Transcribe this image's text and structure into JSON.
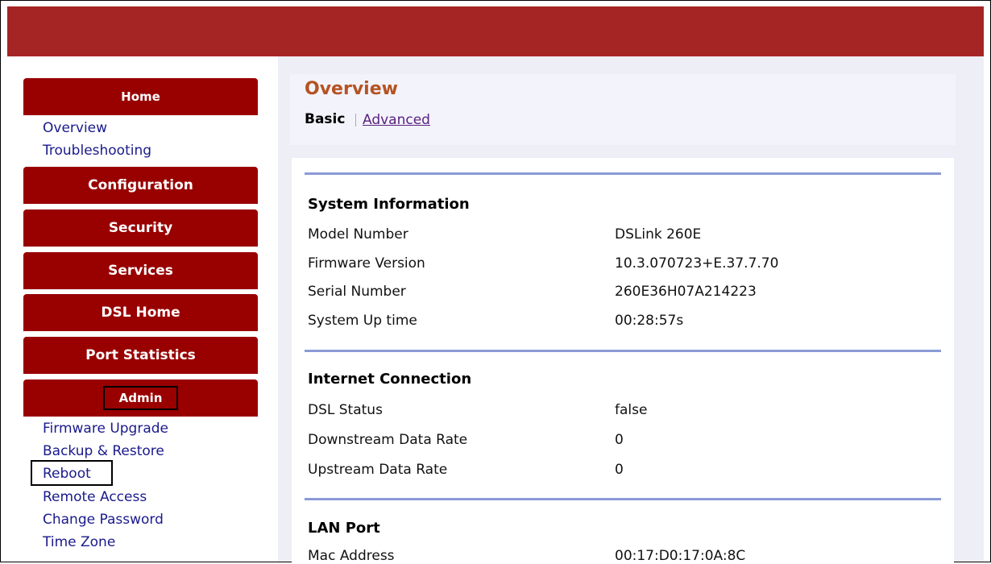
{
  "sidebar": {
    "home": {
      "header": "Home",
      "links": [
        "Overview",
        "Troubleshooting"
      ]
    },
    "configuration": "Configuration",
    "security": "Security",
    "services": "Services",
    "dsl_home": "DSL Home",
    "port_statistics": "Port Statistics",
    "admin": {
      "header": "Admin",
      "links": [
        "Firmware Upgrade",
        "Backup & Restore",
        "Reboot",
        "Remote Access",
        "Change Password",
        "Time Zone"
      ]
    }
  },
  "main": {
    "title": "Overview",
    "tabs": {
      "basic": "Basic",
      "advanced": "Advanced"
    },
    "sections": [
      {
        "title": "System Information",
        "rows": [
          {
            "label": "Model Number",
            "value": "DSLink 260E"
          },
          {
            "label": "Firmware Version",
            "value": "10.3.070723+E.37.7.70"
          },
          {
            "label": "Serial Number",
            "value": "260E36H07A214223"
          },
          {
            "label": "System Up time",
            "value": "00:28:57s"
          }
        ]
      },
      {
        "title": "Internet Connection",
        "rows": [
          {
            "label": "DSL Status",
            "value": "false"
          },
          {
            "label": "Downstream Data Rate",
            "value": "0"
          },
          {
            "label": "Upstream Data Rate",
            "value": "0"
          }
        ]
      },
      {
        "title": "LAN Port",
        "rows": [
          {
            "label": "Mac Address",
            "value": "00:17:D0:17:0A:8C"
          }
        ]
      }
    ]
  },
  "colors": {
    "banner": "#a52525",
    "menu_header": "#990000",
    "title_accent": "#b55323",
    "link": "#1a1a8c",
    "rule": "#8a9ad6"
  }
}
